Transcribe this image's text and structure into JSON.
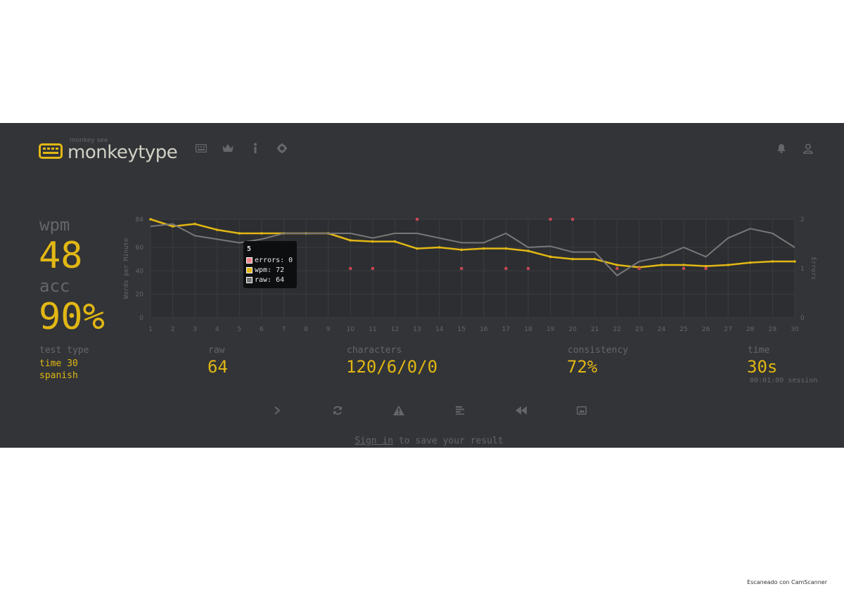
{
  "header": {
    "logo_top": "monkey see",
    "logo_text": "monkeytype",
    "nav_icons": [
      "keyboard-icon",
      "crown-icon",
      "info-icon",
      "gear-icon"
    ],
    "right_icons": [
      "bell-icon",
      "user-icon"
    ]
  },
  "stats": {
    "wpm_label": "wpm",
    "wpm_value": "48",
    "acc_label": "acc",
    "acc_value": "90%",
    "test_type_label": "test type",
    "test_type_mode": "time 30",
    "test_type_language": "spanish",
    "raw_label": "raw",
    "raw_value": "64",
    "characters_label": "characters",
    "characters_value": "120/6/0/0",
    "consistency_label": "consistency",
    "consistency_value": "72%",
    "time_label": "time",
    "time_value": "30s",
    "session_text": "00:01:00 session"
  },
  "tooltip": {
    "title": "5",
    "errors_text": "errors: 0",
    "wpm_text": "wpm: 72",
    "raw_text": "raw: 64"
  },
  "actions": [
    "next-test-icon",
    "restart-icon",
    "warning-icon",
    "words-history-icon",
    "replay-icon",
    "screenshot-icon"
  ],
  "signin": {
    "link_text": "Sign in",
    "rest_text": " to save your result"
  },
  "footer_note": "Escaneado con CamScanner",
  "colors": {
    "background": "#323437",
    "accent": "#e2b714",
    "sub": "#646669",
    "raw_line": "#787878",
    "error": "#ca4754"
  },
  "chart_data": {
    "type": "line",
    "x": [
      1,
      2,
      3,
      4,
      5,
      6,
      7,
      8,
      9,
      10,
      11,
      12,
      13,
      14,
      15,
      16,
      17,
      18,
      19,
      20,
      21,
      22,
      23,
      24,
      25,
      26,
      27,
      28,
      29,
      30
    ],
    "xlim": [
      1,
      30
    ],
    "ylabel": "Words per Minute",
    "ylim": [
      0,
      84
    ],
    "y_ticks": [
      "0",
      "20",
      "40",
      "60",
      "84"
    ],
    "y2label": "Errors",
    "y2lim": [
      0,
      2
    ],
    "y2_ticks": [
      "0",
      "1",
      "2"
    ],
    "grid": true,
    "series": [
      {
        "name": "wpm",
        "axis": "left",
        "color": "#e2b714",
        "values": [
          84,
          78,
          80,
          75,
          72,
          72,
          72,
          72,
          72,
          66,
          65,
          65,
          59,
          60,
          58,
          59,
          59,
          57,
          52,
          50,
          50,
          45,
          43,
          45,
          45,
          44,
          45,
          47,
          48,
          48
        ]
      },
      {
        "name": "raw",
        "axis": "left",
        "color": "#787878",
        "values": [
          78,
          80,
          70,
          67,
          64,
          67,
          72,
          72,
          72,
          72,
          68,
          72,
          72,
          68,
          64,
          64,
          72,
          60,
          61,
          56,
          56,
          36,
          48,
          52,
          60,
          52,
          68,
          76,
          72,
          60
        ]
      },
      {
        "name": "errors",
        "axis": "right",
        "color": "#ca4754",
        "type": "scatter",
        "x": [
          10,
          11,
          13,
          15,
          17,
          18,
          19,
          20,
          22,
          23,
          25,
          26
        ],
        "values": [
          1,
          1,
          2,
          1,
          1,
          1,
          2,
          2,
          1,
          1,
          1,
          1
        ]
      }
    ]
  }
}
